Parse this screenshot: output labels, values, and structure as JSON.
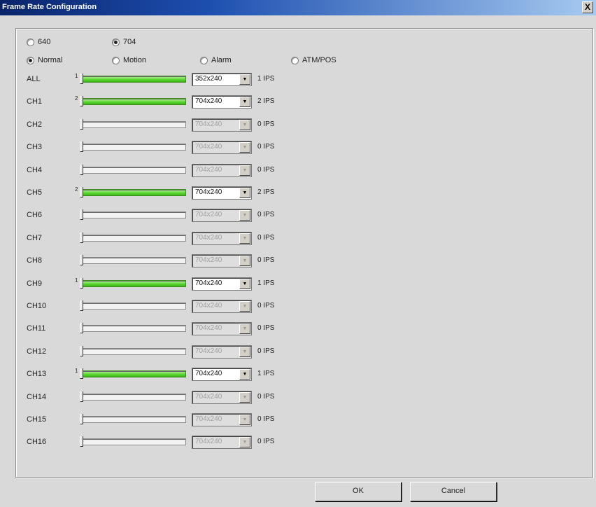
{
  "window": {
    "title": "Frame Rate Configuration",
    "close_label": "X"
  },
  "resolution": {
    "options": [
      {
        "label": "640",
        "checked": false
      },
      {
        "label": "704",
        "checked": true
      }
    ]
  },
  "mode": {
    "options": [
      {
        "label": "Normal",
        "checked": true
      },
      {
        "label": "Motion",
        "checked": false
      },
      {
        "label": "Alarm",
        "checked": false
      },
      {
        "label": "ATM/POS",
        "checked": false
      }
    ]
  },
  "channels": [
    {
      "name": "ALL",
      "active": true,
      "slider_value": "1",
      "resolution": "352x240",
      "ips": "1 IPS",
      "enabled": true
    },
    {
      "name": "CH1",
      "active": true,
      "slider_value": "2",
      "resolution": "704x240",
      "ips": "2 IPS",
      "enabled": true
    },
    {
      "name": "CH2",
      "active": false,
      "slider_value": "",
      "resolution": "704x240",
      "ips": "0 IPS",
      "enabled": false
    },
    {
      "name": "CH3",
      "active": false,
      "slider_value": "",
      "resolution": "704x240",
      "ips": "0 IPS",
      "enabled": false
    },
    {
      "name": "CH4",
      "active": false,
      "slider_value": "",
      "resolution": "704x240",
      "ips": "0 IPS",
      "enabled": false
    },
    {
      "name": "CH5",
      "active": true,
      "slider_value": "2",
      "resolution": "704x240",
      "ips": "2 IPS",
      "enabled": true
    },
    {
      "name": "CH6",
      "active": false,
      "slider_value": "",
      "resolution": "704x240",
      "ips": "0 IPS",
      "enabled": false
    },
    {
      "name": "CH7",
      "active": false,
      "slider_value": "",
      "resolution": "704x240",
      "ips": "0 IPS",
      "enabled": false
    },
    {
      "name": "CH8",
      "active": false,
      "slider_value": "",
      "resolution": "704x240",
      "ips": "0 IPS",
      "enabled": false
    },
    {
      "name": "CH9",
      "active": true,
      "slider_value": "1",
      "resolution": "704x240",
      "ips": "1 IPS",
      "enabled": true
    },
    {
      "name": "CH10",
      "active": false,
      "slider_value": "",
      "resolution": "704x240",
      "ips": "0 IPS",
      "enabled": false
    },
    {
      "name": "CH11",
      "active": false,
      "slider_value": "",
      "resolution": "704x240",
      "ips": "0 IPS",
      "enabled": false
    },
    {
      "name": "CH12",
      "active": false,
      "slider_value": "",
      "resolution": "704x240",
      "ips": "0 IPS",
      "enabled": false
    },
    {
      "name": "CH13",
      "active": true,
      "slider_value": "1",
      "resolution": "704x240",
      "ips": "1 IPS",
      "enabled": true
    },
    {
      "name": "CH14",
      "active": false,
      "slider_value": "",
      "resolution": "704x240",
      "ips": "0 IPS",
      "enabled": false
    },
    {
      "name": "CH15",
      "active": false,
      "slider_value": "",
      "resolution": "704x240",
      "ips": "0 IPS",
      "enabled": false
    },
    {
      "name": "CH16",
      "active": false,
      "slider_value": "",
      "resolution": "704x240",
      "ips": "0 IPS",
      "enabled": false
    }
  ],
  "buttons": {
    "ok": "OK",
    "cancel": "Cancel"
  },
  "colors": {
    "titlebar": "#0a246a",
    "slider_active": "#56d62c",
    "background": "#d9d9d9"
  }
}
